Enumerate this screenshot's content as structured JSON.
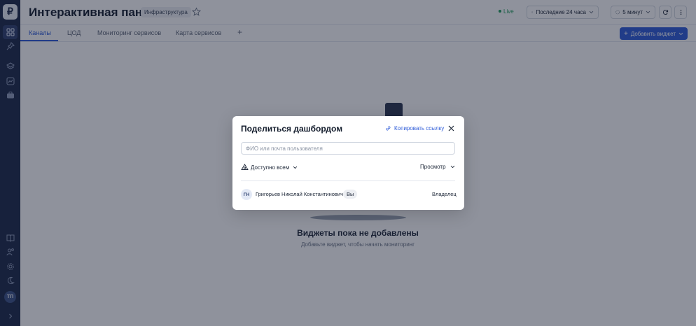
{
  "header": {
    "title": "Интерактивная панель",
    "badge": "Инфраструктура",
    "live_label": "Live",
    "time_range": "Последние 24 часа",
    "refresh_interval": "5 минут"
  },
  "tabs": [
    {
      "label": "Каналы"
    },
    {
      "label": "ЦОД"
    },
    {
      "label": "Мониторинг сервисов"
    },
    {
      "label": "Карта сервисов"
    }
  ],
  "toolbar": {
    "add_tab": "+",
    "add_widget": "Добавить виджет"
  },
  "empty_state": {
    "title": "Виджеты пока не добавлены",
    "subtitle": "Добавьте виджет, чтобы начать мониторинг"
  },
  "sidebar": {
    "logo": "₽",
    "avatar_initials": "ТП",
    "icons": [
      "dashboard-icon",
      "pin-icon",
      "layers-icon",
      "chart-icon",
      "briefcase-icon",
      "book-icon",
      "users-icon",
      "settings-icon",
      "moon-icon",
      "chevron-right-icon"
    ]
  },
  "modal": {
    "title": "Поделиться дашбордом",
    "copy_link": "Копировать ссылку",
    "input_placeholder": "ФИО или почта пользователя",
    "access_label": "Доступно всем",
    "permission": "Просмотр",
    "members": [
      {
        "initials": "ГН",
        "name": "Григорьев Николай Константинович",
        "badge": "Вы",
        "role": "Владелец"
      }
    ]
  },
  "colors": {
    "sidebar": "#1a2848",
    "accent": "#2d5bd8",
    "live": "#1e9e5a"
  }
}
